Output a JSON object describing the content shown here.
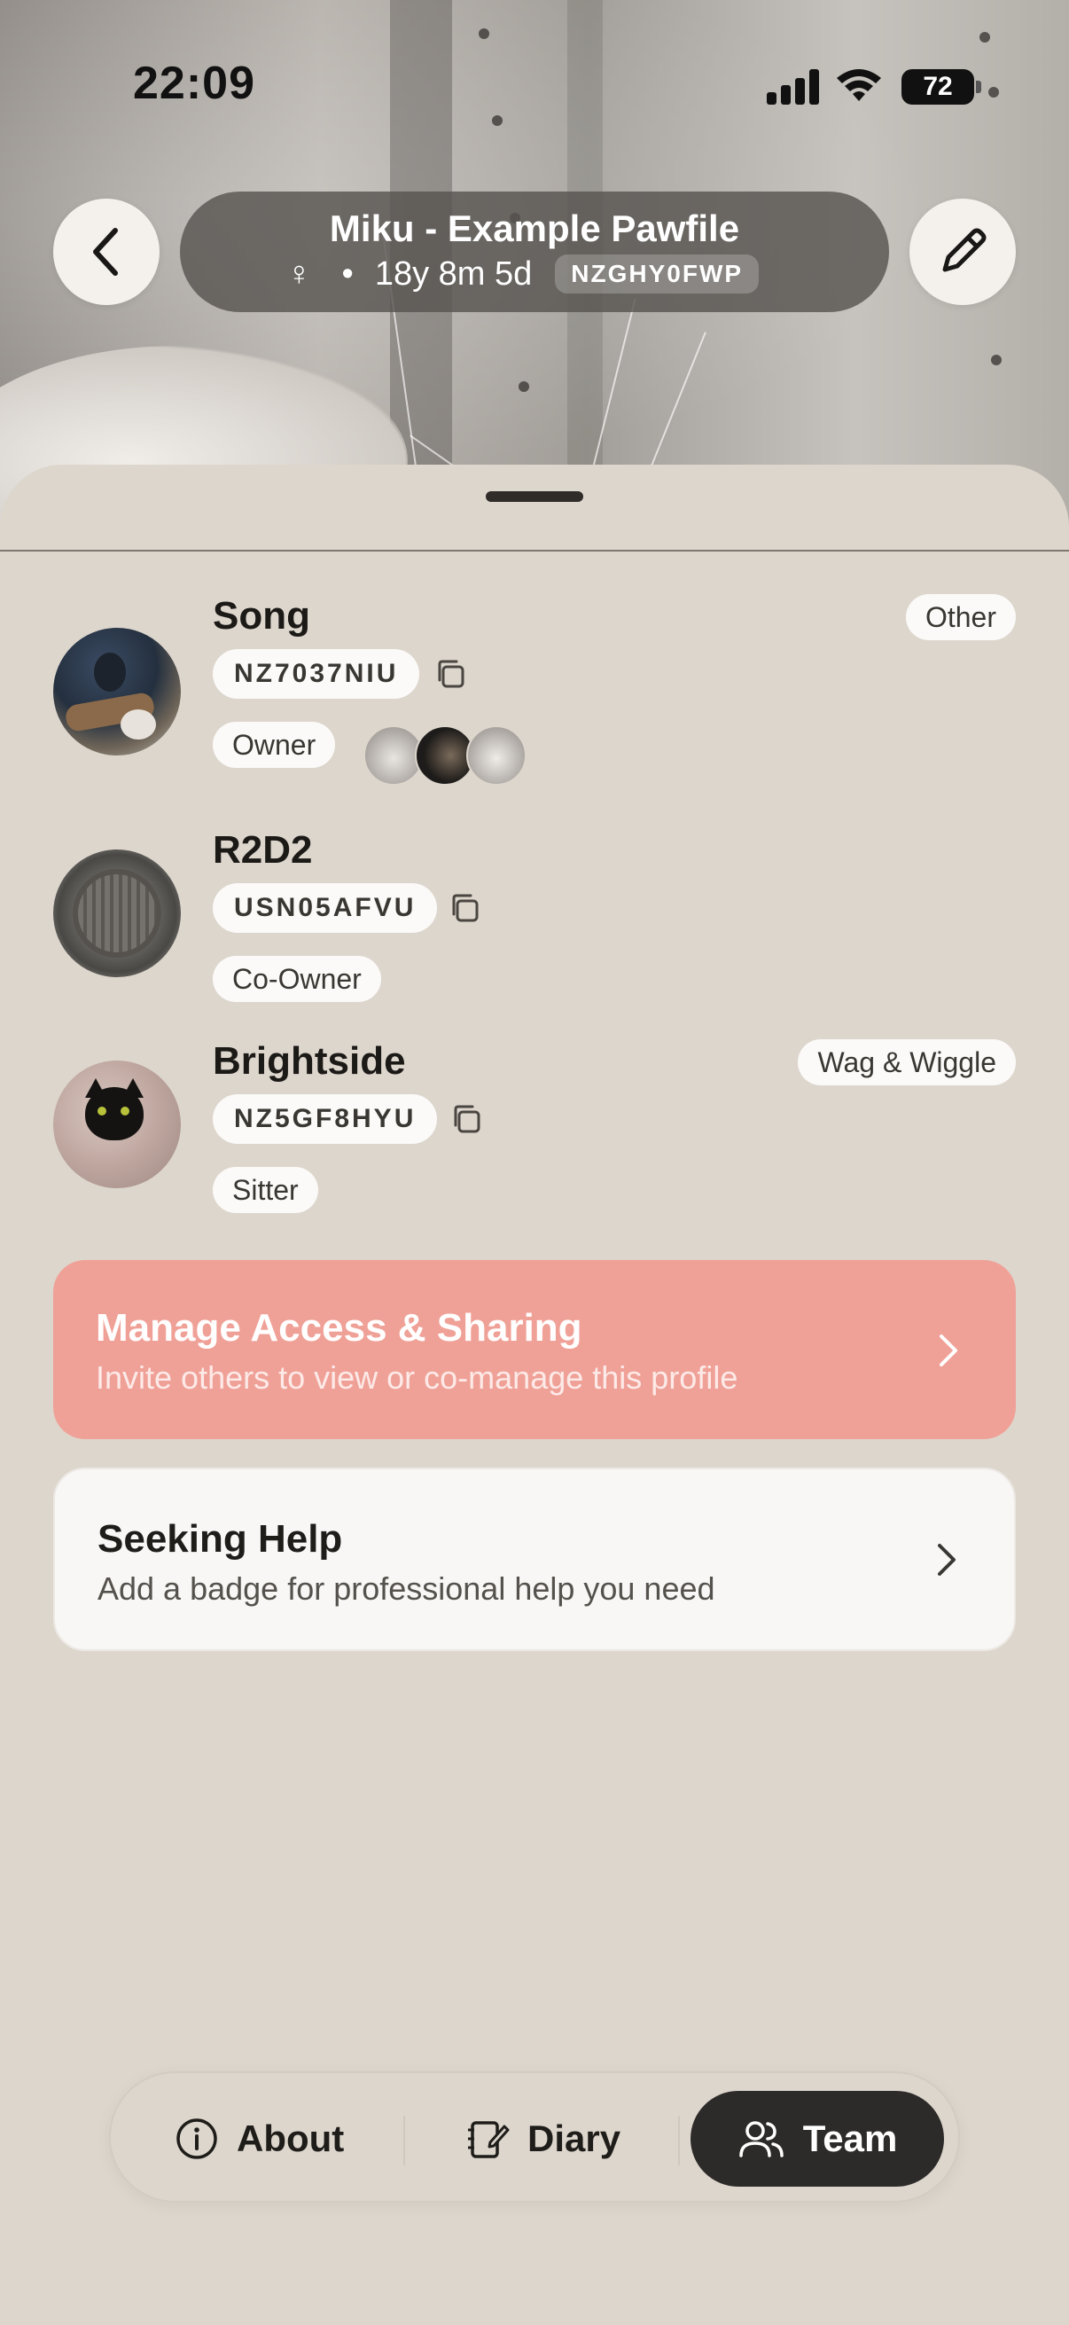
{
  "status_bar": {
    "time": "22:09",
    "battery": "72"
  },
  "header": {
    "title": "Miku - Example Pawfile",
    "sex_symbol": "♀",
    "separator": "•",
    "age": "18y 8m 5d",
    "code": "NZGHY0FWP"
  },
  "icons": {
    "back": "chevron-left-icon",
    "edit": "pencil-icon",
    "copy": "copy-icon",
    "chevron": "chevron-right-icon",
    "about": "info-icon",
    "diary": "notebook-icon",
    "team": "users-icon"
  },
  "members": [
    {
      "name": "Song",
      "id": "NZ7037NIU",
      "role": "Owner",
      "tag": "Other"
    },
    {
      "name": "R2D2",
      "id": "USN05AFVU",
      "role": "Co-Owner",
      "tag": ""
    },
    {
      "name": "Brightside",
      "id": "NZ5GF8HYU",
      "role": "Sitter",
      "tag": "Wag & Wiggle"
    }
  ],
  "cards": {
    "access": {
      "title": "Manage Access & Sharing",
      "subtitle": "Invite others to view or co-manage this profile"
    },
    "help": {
      "title": "Seeking Help",
      "subtitle": "Add a badge for professional help you need"
    }
  },
  "tabs": [
    {
      "label": "About",
      "active": false
    },
    {
      "label": "Diary",
      "active": false
    },
    {
      "label": "Team",
      "active": true
    }
  ],
  "colors": {
    "background": "#ddd6cd",
    "accent_card": "#f0a197",
    "active_tab": "#2d2b29"
  }
}
